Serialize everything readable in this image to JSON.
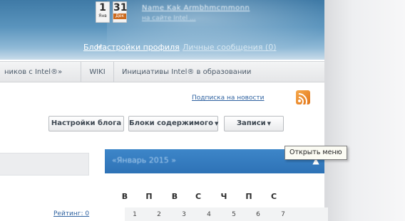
{
  "header": {
    "calendar_icon_1": {
      "num": "1",
      "month": "Янв"
    },
    "calendar_icon_2": {
      "num": "31",
      "month": "Дек"
    },
    "user_name": "Name Kak Armbhmcmmonn",
    "user_sub": "на сайте Intel ...",
    "nav": {
      "blog": "Блог",
      "settings": "Настройки профиля",
      "messages": "Личные сообщения (0)"
    }
  },
  "tabs": [
    {
      "label": "ников с Intel®»"
    },
    {
      "label": "WIKI"
    },
    {
      "label": "Инициативы Intel® в образовании"
    }
  ],
  "subscribe": {
    "label": "Подписка на новости",
    "icon": "rss-icon"
  },
  "toolbar": {
    "blog_settings": "Настройки блога",
    "content_blocks": "Блоки содержимого",
    "posts": "Записи"
  },
  "tooltip": "Открыть меню",
  "calendar": {
    "title": "«Январь 2015 »",
    "weekdays": [
      "В",
      "П",
      "В",
      "С",
      "Ч",
      "П",
      "С"
    ],
    "days": [
      "1",
      "2",
      "3",
      "4",
      "5",
      "6",
      "7"
    ]
  },
  "rating": "Рейтинг: 0"
}
